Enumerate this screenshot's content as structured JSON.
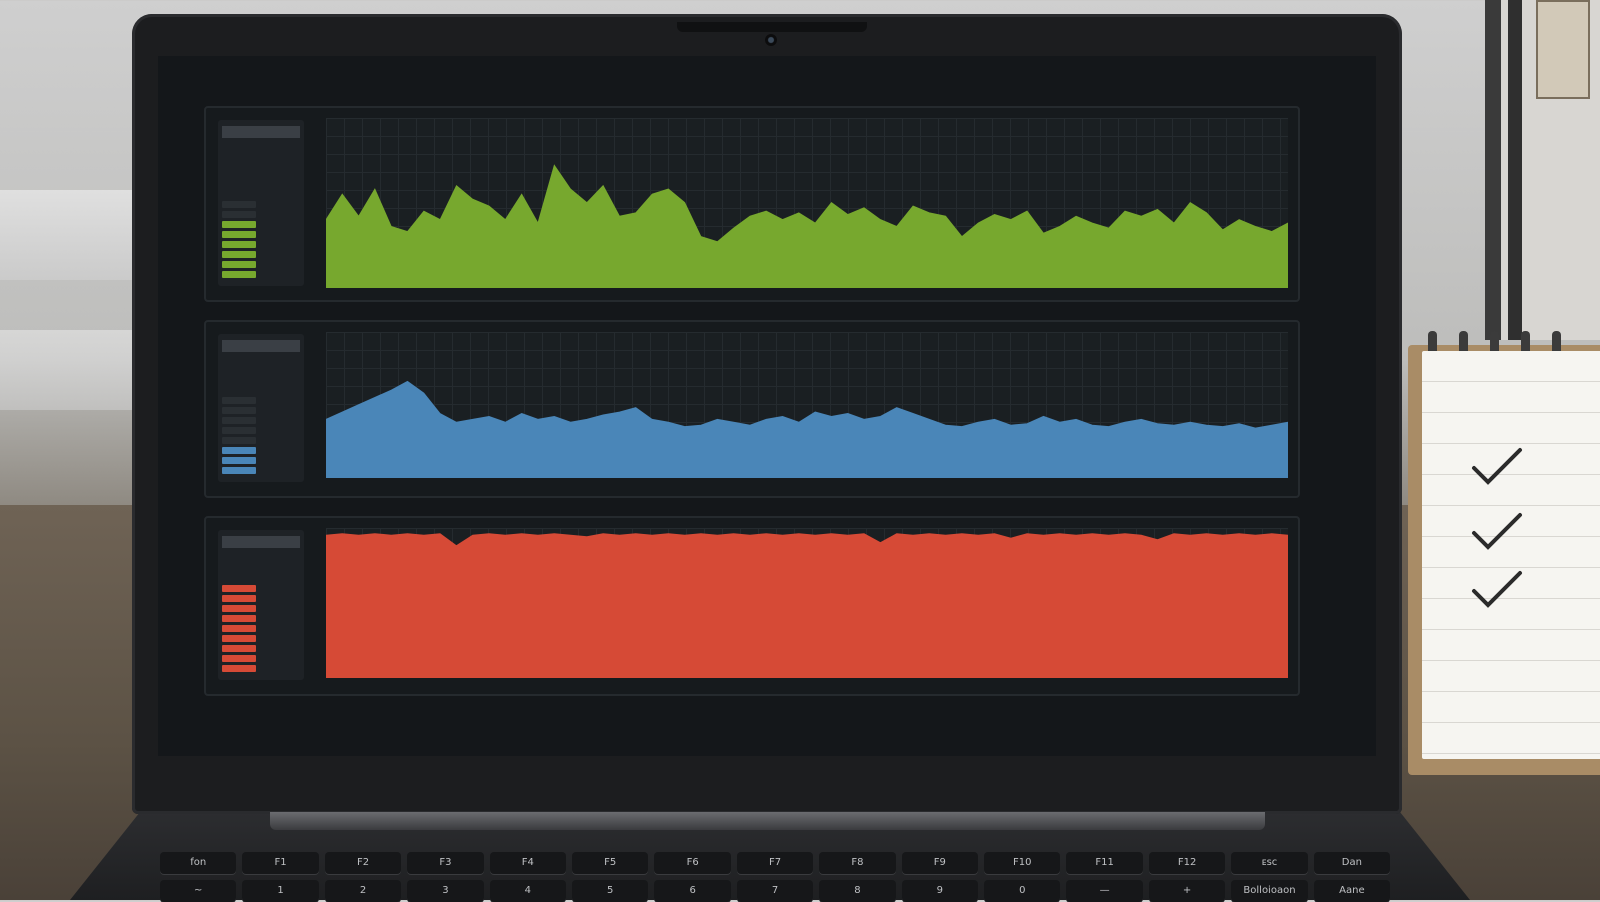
{
  "colors": {
    "cpu": "#77a82e",
    "network": "#4a86b8",
    "memory": "#d64a36",
    "background": "#14171a"
  },
  "panels": [
    {
      "id": "green",
      "level": 6,
      "max_level": 8,
      "series": [
        0.4,
        0.55,
        0.42,
        0.58,
        0.36,
        0.33,
        0.45,
        0.4,
        0.6,
        0.52,
        0.48,
        0.4,
        0.55,
        0.38,
        0.72,
        0.58,
        0.5,
        0.6,
        0.42,
        0.44,
        0.55,
        0.58,
        0.5,
        0.3,
        0.27,
        0.35,
        0.42,
        0.45,
        0.4,
        0.44,
        0.38,
        0.5,
        0.43,
        0.47,
        0.4,
        0.36,
        0.48,
        0.44,
        0.42,
        0.3,
        0.38,
        0.43,
        0.4,
        0.45,
        0.32,
        0.36,
        0.42,
        0.38,
        0.35,
        0.45,
        0.42,
        0.46,
        0.38,
        0.5,
        0.44,
        0.34,
        0.4,
        0.36,
        0.33,
        0.38
      ]
    },
    {
      "id": "blue",
      "level": 3,
      "max_level": 8,
      "series": [
        0.4,
        0.45,
        0.5,
        0.55,
        0.6,
        0.66,
        0.58,
        0.44,
        0.38,
        0.4,
        0.42,
        0.38,
        0.44,
        0.4,
        0.42,
        0.38,
        0.4,
        0.43,
        0.45,
        0.48,
        0.4,
        0.38,
        0.35,
        0.36,
        0.4,
        0.38,
        0.36,
        0.4,
        0.42,
        0.38,
        0.45,
        0.42,
        0.44,
        0.4,
        0.42,
        0.48,
        0.44,
        0.4,
        0.36,
        0.35,
        0.38,
        0.4,
        0.36,
        0.37,
        0.42,
        0.38,
        0.4,
        0.36,
        0.35,
        0.38,
        0.4,
        0.37,
        0.36,
        0.38,
        0.36,
        0.35,
        0.37,
        0.34,
        0.36,
        0.38
      ]
    },
    {
      "id": "red",
      "level": 9,
      "max_level": 9,
      "series": [
        0.95,
        0.96,
        0.95,
        0.96,
        0.95,
        0.96,
        0.95,
        0.96,
        0.88,
        0.95,
        0.96,
        0.95,
        0.96,
        0.95,
        0.96,
        0.95,
        0.94,
        0.96,
        0.95,
        0.96,
        0.95,
        0.96,
        0.95,
        0.96,
        0.95,
        0.96,
        0.95,
        0.96,
        0.95,
        0.96,
        0.95,
        0.96,
        0.95,
        0.96,
        0.9,
        0.96,
        0.95,
        0.96,
        0.95,
        0.96,
        0.95,
        0.96,
        0.93,
        0.96,
        0.95,
        0.96,
        0.95,
        0.96,
        0.95,
        0.96,
        0.95,
        0.92,
        0.96,
        0.95,
        0.96,
        0.95,
        0.96,
        0.95,
        0.96,
        0.95
      ]
    }
  ],
  "keyboard": {
    "fn_row": [
      "fon",
      "F1",
      "F2",
      "F3",
      "F4",
      "F5",
      "F6",
      "F7",
      "F8",
      "F9",
      "F10",
      "F11",
      "F12",
      "ᴇsc",
      "Dan"
    ],
    "num_row": [
      "~",
      "1",
      "2",
      "3",
      "4",
      "5",
      "6",
      "7",
      "8",
      "9",
      "0",
      "—",
      "+",
      "Bolloioaon",
      "Aane"
    ]
  }
}
